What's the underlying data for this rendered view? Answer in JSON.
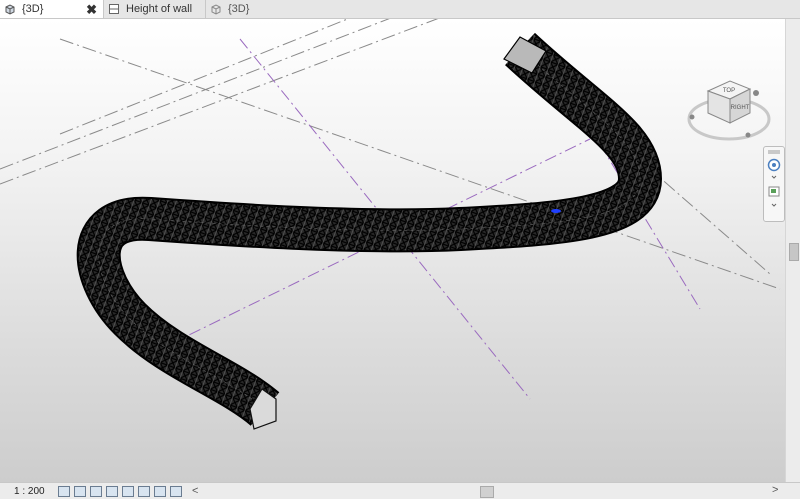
{
  "tabs": [
    {
      "label": "{3D}",
      "active": true,
      "close": "✖"
    },
    {
      "label": "Height of wall",
      "active": false
    },
    {
      "label": "{3D}",
      "active": false
    }
  ],
  "viewcube": {
    "top_label": "TOP",
    "face_label": "RIGHT"
  },
  "statusbar": {
    "scale": "1 : 200",
    "scroll_left": "<",
    "scroll_right": ">"
  },
  "colors": {
    "accent": "#4a7fc0",
    "level_line": "#9a6abf",
    "mesh": "#0a0a0a"
  }
}
